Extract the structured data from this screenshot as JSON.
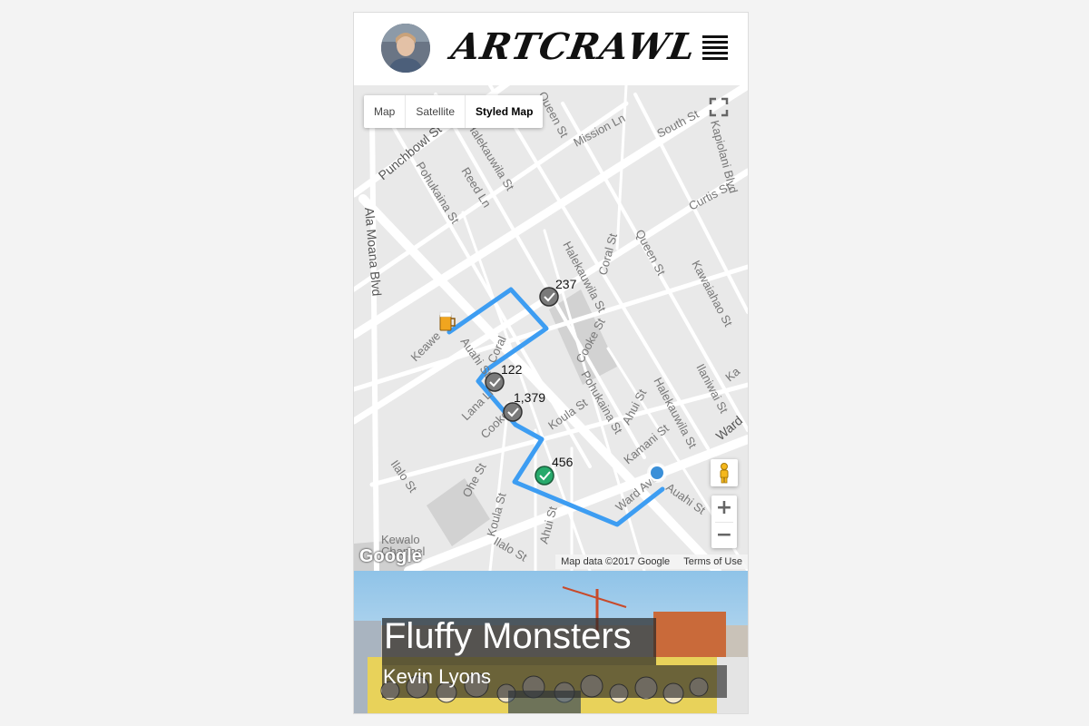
{
  "app": {
    "logo_text": "ARTCRAWL",
    "menu_icon": "hamburger-menu-icon"
  },
  "map": {
    "type_buttons": [
      {
        "label": "Map",
        "active": false
      },
      {
        "label": "Satellite",
        "active": false
      },
      {
        "label": "Styled Map",
        "active": true
      }
    ],
    "streets": {
      "queen_top": "Queen St",
      "mission": "Mission Ln",
      "south": "South St",
      "kapiolani": "Kapiolani Blvd",
      "punchbowl": "Punchbowl St",
      "halekauwila_top": "Halekauwila St",
      "pohukaina_top": "Pohukaina St",
      "reed": "Reed Ln",
      "curtis": "Curtis St",
      "ala_moana": "Ala Moana Blvd",
      "halekauwila_mid": "Halekauwila St",
      "coral": "Coral St",
      "queen_mid": "Queen St",
      "kawaiahao": "Kawaiahao St",
      "keawe": "Keawe",
      "auahi_left": "Auahi St",
      "coral_low": "Coral",
      "cooke_mid": "Cooke St",
      "pohukaina_low": "Pohukaina St",
      "ahui_mid": "Ahui St",
      "halekauwila_low": "Halekauwila St",
      "ilaniwai": "Ilaniwai St",
      "kamani": "Kamani St",
      "ward": "Ward",
      "ka": "Ka",
      "lana": "Lana Ln",
      "cooke_low": "Cooke",
      "koula_mid": "Koula St",
      "ilalo_left": "Ilalo St",
      "ohe": "Ohe St",
      "koula_low": "Koula St",
      "ahui_low": "Ahui St",
      "ward_ave": "Ward Ave",
      "auahi_right": "Auahi St",
      "kewalo": "Kewalo",
      "channel": "Channel",
      "ilalo_low": "Ilalo St"
    },
    "markers": [
      {
        "label": "237",
        "visited": true,
        "color": "#7a7a7a"
      },
      {
        "label": "122",
        "visited": true,
        "color": "#7a7a7a"
      },
      {
        "label": "1,379",
        "visited": true,
        "color": "#7a7a7a"
      },
      {
        "label": "456",
        "visited": true,
        "color": "#27a96b"
      }
    ],
    "route_color": "#3d9df2",
    "start_icon": "beer-mug-icon",
    "location_dot_color": "#3a8fd8",
    "google_logo": "Google",
    "attribution": "Map data ©2017 Google",
    "terms": "Terms of Use",
    "zoom_in": "+",
    "zoom_out": "−"
  },
  "artwork": {
    "title": "Fluffy Monsters",
    "artist": "Kevin Lyons"
  }
}
